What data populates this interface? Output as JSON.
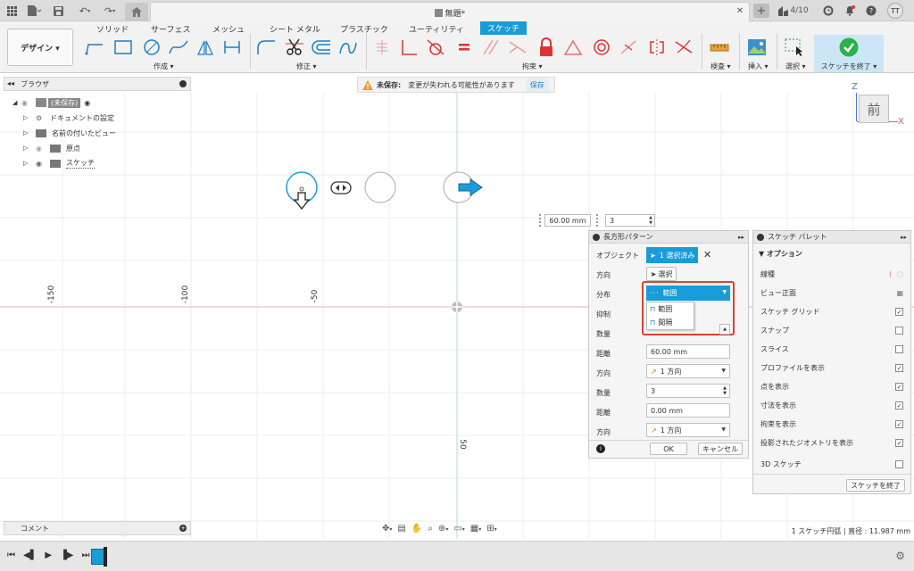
{
  "titlebar": {
    "doc_title": "無題*",
    "counter": "4/10",
    "user_initials": "TT"
  },
  "ribbon": {
    "workspace_label": "デザイン ▾",
    "tabs": [
      "ソリッド",
      "サーフェス",
      "メッシュ",
      "シート メタル",
      "プラスチック",
      "ユーティリティ",
      "スケッチ"
    ],
    "groups": {
      "create": "作成 ▾",
      "modify": "修正 ▾",
      "constraints": "拘束 ▾",
      "inspect": "検査 ▾",
      "insert": "挿入 ▾",
      "select": "選択 ▾",
      "finish": "スケッチを終了 ▾"
    }
  },
  "browser": {
    "title": "ブラウザ",
    "items": [
      {
        "label": "(未保存)"
      },
      {
        "label": "ドキュメントの設定"
      },
      {
        "label": "名前の付いたビュー"
      },
      {
        "label": "原点"
      },
      {
        "label": "スケッチ"
      }
    ]
  },
  "warning": {
    "prefix": "未保存:",
    "message": "変更が失われる可能性があります",
    "save_label": "保存"
  },
  "viewcube": {
    "face": "前",
    "z": "Z",
    "x": "X"
  },
  "canvas": {
    "axis_labels": [
      "-150",
      "-100",
      "-50",
      "50"
    ],
    "dim_input": "60.00 mm",
    "count_input": "3"
  },
  "rect_pattern": {
    "title": "長方形パターン",
    "rows": {
      "object_label": "オブジェクト",
      "object_value": "1 選択済み",
      "direction_label": "方向",
      "direction_value": "選択",
      "distribution_label": "分布",
      "distribution_value": "範囲",
      "suppress_label": "抑制",
      "count1_label": "数量",
      "distance1_label": "距離",
      "distance1_value": "60.00 mm",
      "direction2_label": "方向",
      "direction2_value": "1 方向",
      "count2_label": "数量",
      "count2_value": "3",
      "distance2_label": "距離",
      "distance2_value": "0.00 mm",
      "direction3_label": "方向",
      "direction3_value": "1 方向"
    },
    "dropdown_options": [
      "範囲",
      "間隔"
    ],
    "ok_label": "OK",
    "cancel_label": "キャンセル"
  },
  "sketch_palette": {
    "title": "スケッチ パレット",
    "section": "オプション",
    "rows": [
      {
        "label": "線種",
        "checked": null
      },
      {
        "label": "ビュー正面",
        "checked": null
      },
      {
        "label": "スケッチ グリッド",
        "checked": true
      },
      {
        "label": "スナップ",
        "checked": false
      },
      {
        "label": "スライス",
        "checked": false
      },
      {
        "label": "プロファイルを表示",
        "checked": true
      },
      {
        "label": "点を表示",
        "checked": true
      },
      {
        "label": "寸法を表示",
        "checked": true
      },
      {
        "label": "拘束を表示",
        "checked": true
      },
      {
        "label": "投影されたジオメトリを表示",
        "checked": true
      },
      {
        "label": "3D スケッチ",
        "checked": false
      }
    ],
    "finish_label": "スケッチを終了"
  },
  "comments": {
    "title": "コメント"
  },
  "status": {
    "text": "1 スケッチ円弧 | 直径 : 11.987 mm"
  },
  "colors": {
    "accent": "#1a9cd8",
    "highlight_border": "#d9442b",
    "finish_green": "#2ab24a"
  }
}
